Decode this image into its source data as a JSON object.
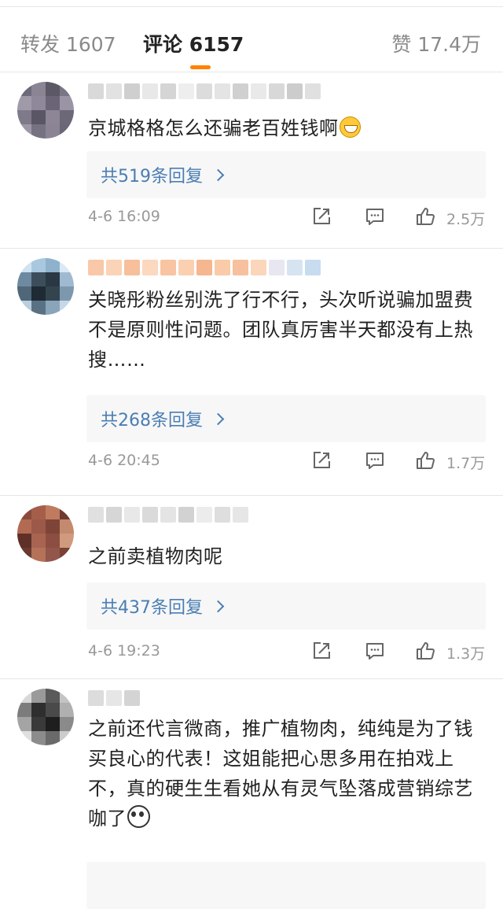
{
  "tabs": {
    "repost": {
      "label": "转发",
      "count": "1607"
    },
    "comments": {
      "label": "评论",
      "count": "6157"
    },
    "likes": {
      "label": "赞",
      "count": "17.4万"
    }
  },
  "comments": [
    {
      "text": "京城格格怎么还骗老百姓钱啊",
      "emoji": "grinning-sweat-emoji",
      "replies": "共519条回复",
      "time": "4-6 16:09",
      "likes": "2.5万",
      "avatar_colors": [
        "#6e6a7a",
        "#8a8494",
        "#5c5866",
        "#7b7686",
        "#a09aa8",
        "#8e889a",
        "#6a6476",
        "#9a94a4",
        "#7f7a8a",
        "#5a5664",
        "#8c8696",
        "#6c6878",
        "#9e98a6",
        "#777282",
        "#8a8494",
        "#6a6676"
      ],
      "username_colors": [
        "#d9d9d9",
        "#e2e2e2",
        "#cfcfcf",
        "#e8e8e8",
        "#d5d5d5",
        "#eeeeee",
        "#dcdcdc",
        "#e4e4e4",
        "#d0d0d0",
        "#e9e9e9",
        "#d8d8d8",
        "#cccccc",
        "#e0e0e0"
      ]
    },
    {
      "text": "关晓彤粉丝别洗了行不行，头次听说骗加盟费不是原则性问题。团队真厉害半天都没有上热 搜……",
      "replies": "共268条回复",
      "time": "4-6 20:45",
      "likes": "1.7万",
      "avatar_colors": [
        "#cfe3f2",
        "#a9c8e0",
        "#8fb2cc",
        "#dbe9f4",
        "#6d8aa0",
        "#3c4e5c",
        "#2a3844",
        "#9fbad0",
        "#50677a",
        "#1e2a34",
        "#34444f",
        "#7d98ad",
        "#b9cfe0",
        "#5a7184",
        "#8aa5ba",
        "#c4d8e8"
      ],
      "username_colors": [
        "#f9c8a8",
        "#fbd3b6",
        "#f7bf9c",
        "#fcd8bf",
        "#f8c4a2",
        "#fad0b0",
        "#f5b690",
        "#f9cba9",
        "#f7c09e",
        "#fbd6ba",
        "#e8e6f0",
        "#d6e4f2",
        "#c8dcf0"
      ]
    },
    {
      "text": "之前卖植物肉呢",
      "replies": "共437条回复",
      "time": "4-6 19:23",
      "likes": "1.3万",
      "avatar_colors": [
        "#8a4a3c",
        "#a55e4a",
        "#c07a5e",
        "#6e3a30",
        "#b36a52",
        "#9c5848",
        "#7e4438",
        "#c48a6e",
        "#5e3028",
        "#a86450",
        "#8c4e40",
        "#d09a7e",
        "#6a3a2e",
        "#b47258",
        "#92564a",
        "#7a4234"
      ],
      "username_colors": [
        "#e0e0e0",
        "#d6d6d6",
        "#e8e8e8",
        "#dadada",
        "#e4e4e4",
        "#d2d2d2",
        "#ececec",
        "#dedede",
        "#e6e6e6"
      ]
    },
    {
      "text": "之前还代言微商，推广植物肉，纯纯是为了钱买良心的代表！这姐能把心思多用在拍戏上不，真的硬生生看她从有灵气坠落成营销综艺咖了",
      "emoji": "panda-emoji",
      "avatar_colors": [
        "#d8d8d8",
        "#9a9a9a",
        "#5a5a5a",
        "#c4c4c4",
        "#7c7c7c",
        "#2e2e2e",
        "#4a4a4a",
        "#b0b0b0",
        "#a4a4a4",
        "#3a3a3a",
        "#1e1e1e",
        "#8a8a8a",
        "#e0e0e0",
        "#8c8c8c",
        "#6a6a6a",
        "#cccccc"
      ],
      "username_colors": [
        "#dcdcdc",
        "#e6e6e6",
        "#d4d4d4"
      ]
    }
  ]
}
